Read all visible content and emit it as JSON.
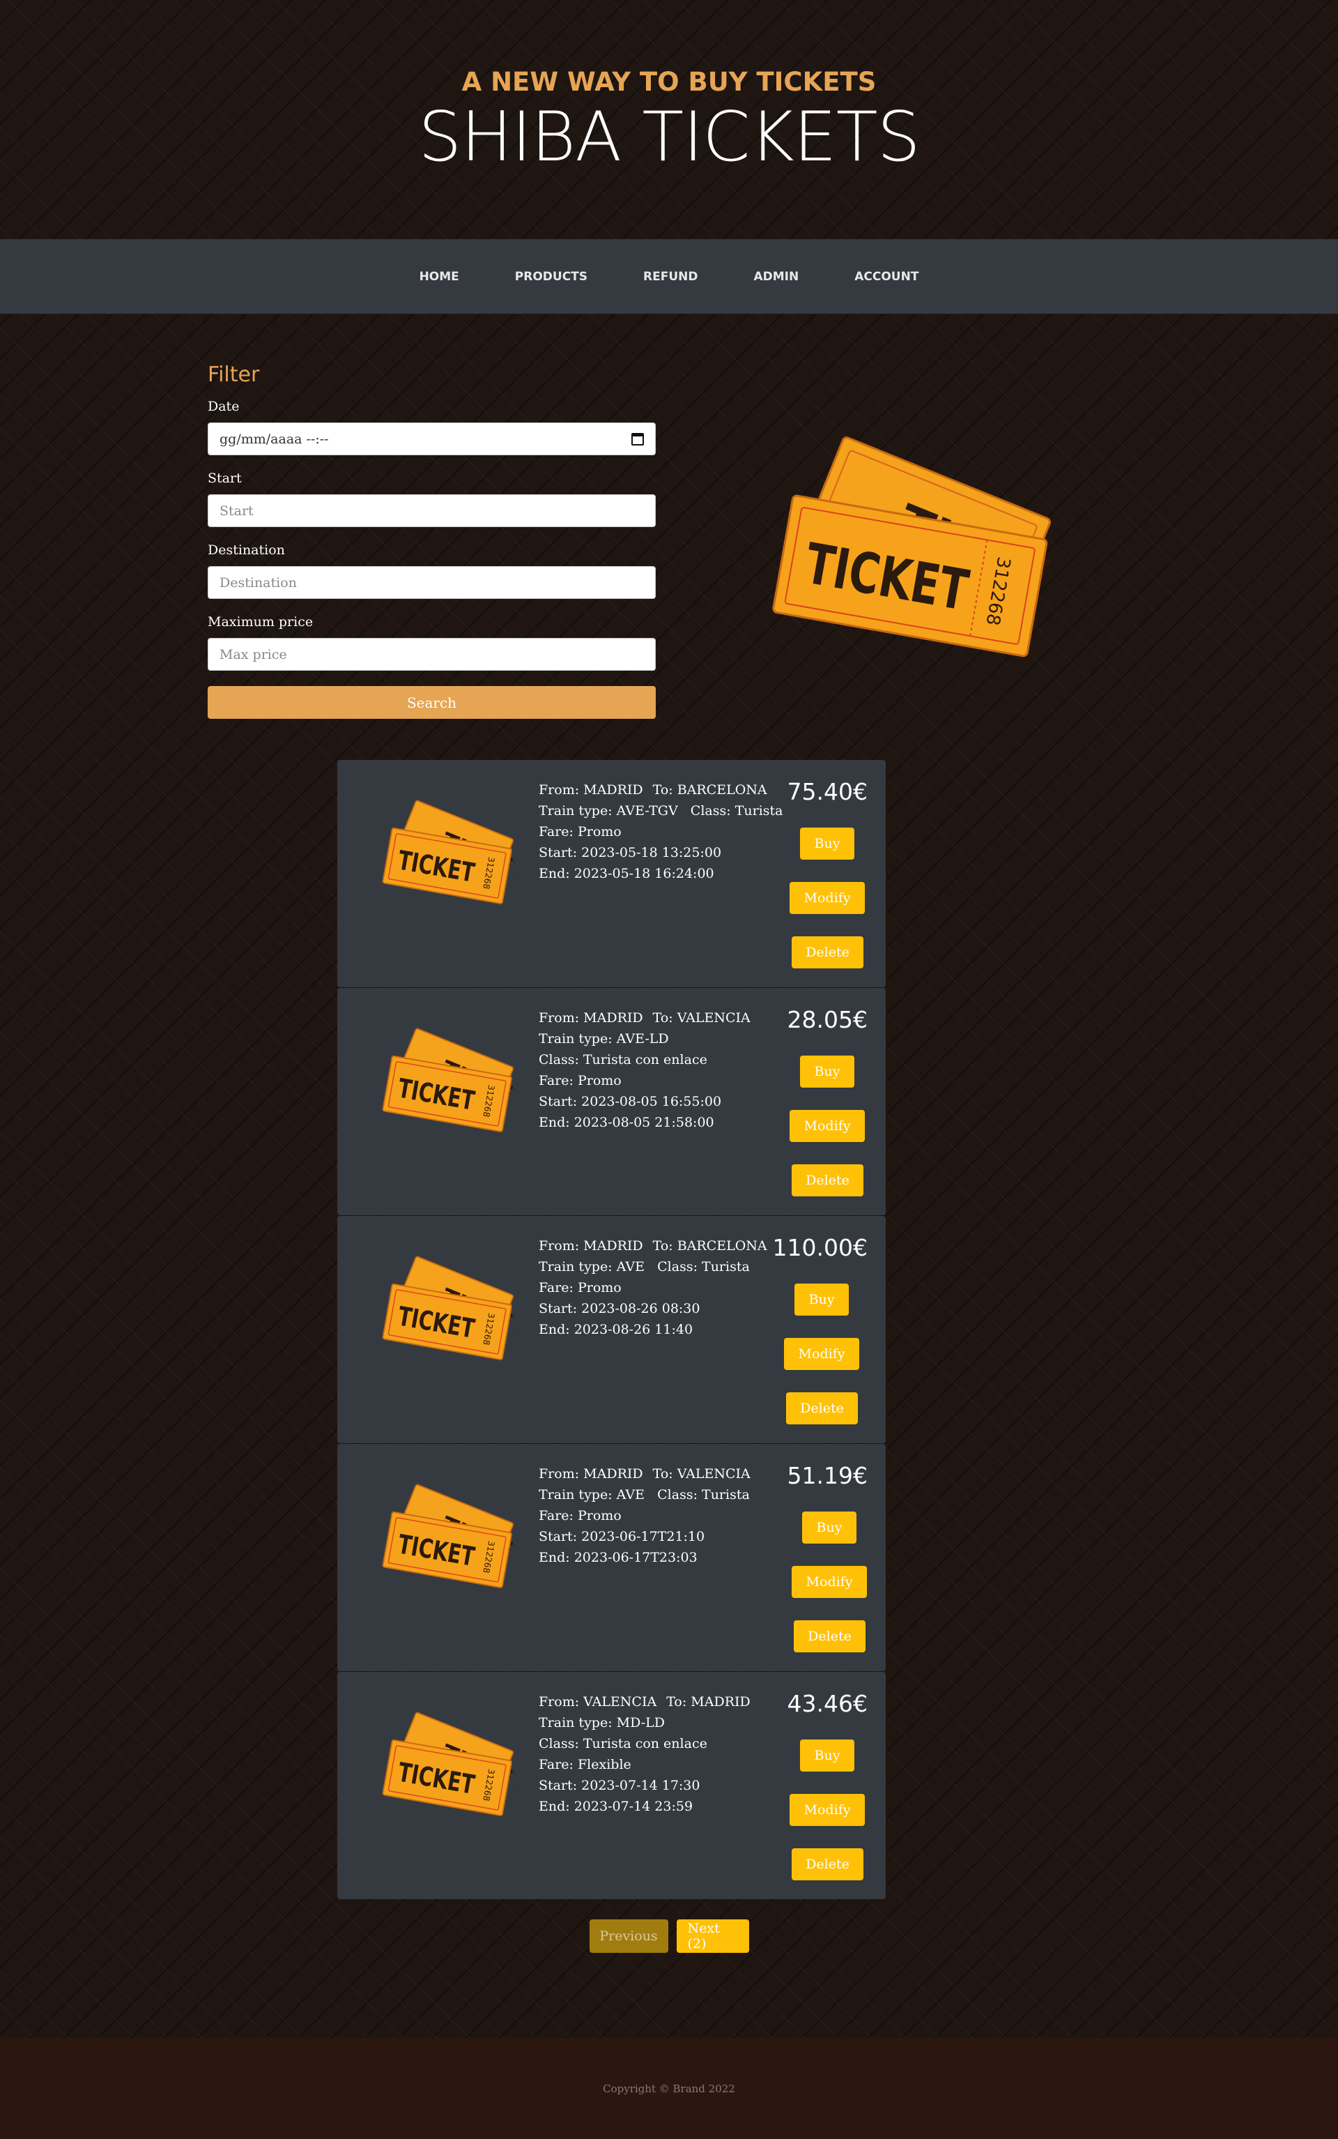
{
  "header": {
    "tagline": "A NEW WAY TO BUY TICKETS",
    "title": "SHIBA TICKETS"
  },
  "nav": {
    "items": [
      "HOME",
      "PRODUCTS",
      "REFUND",
      "ADMIN",
      "ACCOUNT"
    ]
  },
  "filter": {
    "heading": "Filter",
    "date_label": "Date",
    "date_value": "gg/mm/aaaa --:--",
    "start_label": "Start",
    "start_placeholder": "Start",
    "destination_label": "Destination",
    "destination_placeholder": "Destination",
    "price_label": "Maximum price",
    "price_placeholder": "Max price",
    "search_label": "Search"
  },
  "ticket_image_text": {
    "word": "TICKET",
    "number": "312268"
  },
  "tickets": [
    {
      "from": "From: MADRID",
      "to": "To: BARCELONA",
      "lines": [
        "Train type: AVE-TGV   Class: Turista",
        "Fare: Promo",
        "Start: 2023-05-18 13:25:00",
        "End: 2023-05-18 16:24:00"
      ],
      "price": "75.40€",
      "buy": "Buy",
      "modify": "Modify",
      "delete": "Delete"
    },
    {
      "from": "From: MADRID",
      "to": "To: VALENCIA",
      "lines": [
        "Train type: AVE-LD",
        "Class: Turista con enlace",
        "Fare: Promo",
        "Start: 2023-08-05 16:55:00",
        "End: 2023-08-05 21:58:00"
      ],
      "price": "28.05€",
      "buy": "Buy",
      "modify": "Modify",
      "delete": "Delete"
    },
    {
      "from": "From: MADRID",
      "to": "To: BARCELONA",
      "lines": [
        "Train type: AVE   Class: Turista",
        "Fare: Promo",
        "Start: 2023-08-26 08:30",
        "End: 2023-08-26 11:40"
      ],
      "price": "110.00€",
      "buy": "Buy",
      "modify": "Modify",
      "delete": "Delete"
    },
    {
      "from": "From: MADRID",
      "to": "To: VALENCIA",
      "lines": [
        "Train type: AVE   Class: Turista",
        "Fare: Promo",
        "Start: 2023-06-17T21:10",
        "End: 2023-06-17T23:03"
      ],
      "price": "51.19€",
      "buy": "Buy",
      "modify": "Modify",
      "delete": "Delete"
    },
    {
      "from": "From: VALENCIA",
      "to": "To: MADRID",
      "lines": [
        "Train type: MD-LD",
        "Class: Turista con enlace",
        "Fare: Flexible",
        "Start: 2023-07-14 17:30",
        "End: 2023-07-14 23:59"
      ],
      "price": "43.46€",
      "buy": "Buy",
      "modify": "Modify",
      "delete": "Delete"
    }
  ],
  "pagination": {
    "previous": "Previous",
    "next": "Next (2)"
  },
  "footer": {
    "copyright": "Copyright © Brand 2022"
  },
  "colors": {
    "accent": "#e6a554",
    "nav_bg": "#343a40",
    "button_yellow": "#ffc107",
    "ticket_orange": "#f7a21b"
  }
}
